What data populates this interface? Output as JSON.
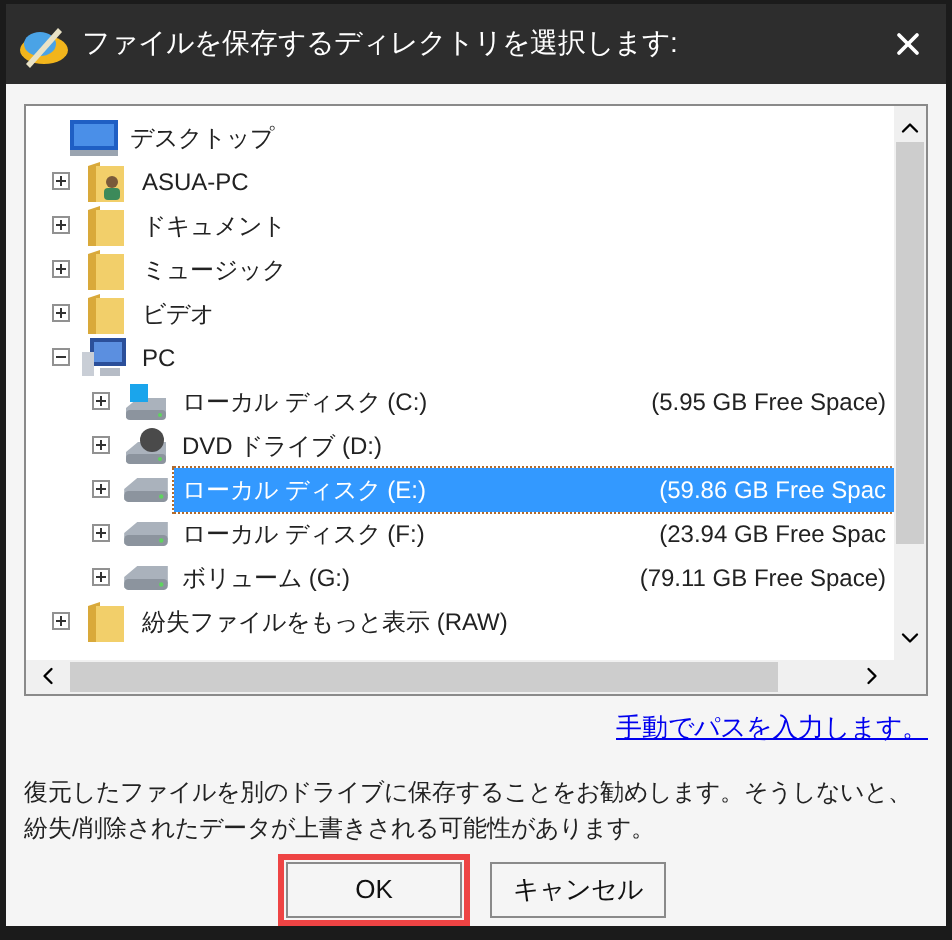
{
  "window": {
    "title": "ファイルを保存するディレクトリを選択します:"
  },
  "tree": [
    {
      "label": "デスクトップ",
      "kind": "desktop",
      "selected": false,
      "children": [
        {
          "label": "ASUA-PC",
          "kind": "user-folder",
          "expanded": false,
          "selected": false
        },
        {
          "label": "ドキュメント",
          "kind": "folder",
          "expanded": false,
          "selected": false
        },
        {
          "label": "ミュージック",
          "kind": "folder",
          "expanded": false,
          "selected": false
        },
        {
          "label": "ビデオ",
          "kind": "folder",
          "expanded": false,
          "selected": false
        },
        {
          "label": "PC",
          "kind": "pc",
          "expanded": true,
          "selected": false,
          "children": [
            {
              "label": "ローカル ディスク (C:)",
              "kind": "windows-drive",
              "free": "(5.95 GB Free Space)",
              "expanded": false,
              "selected": false
            },
            {
              "label": "DVD ドライブ (D:)",
              "kind": "dvd",
              "expanded": false,
              "selected": false
            },
            {
              "label": "ローカル ディスク (E:)",
              "kind": "drive",
              "free": "(59.86 GB Free Spac",
              "expanded": false,
              "selected": true
            },
            {
              "label": "ローカル ディスク (F:)",
              "kind": "drive",
              "free": "(23.94 GB Free Spac",
              "expanded": false,
              "selected": false
            },
            {
              "label": "ボリューム (G:)",
              "kind": "drive",
              "free": "(79.11 GB Free Space)",
              "expanded": false,
              "selected": false
            }
          ]
        },
        {
          "label": "紛失ファイルをもっと表示 (RAW)",
          "kind": "folder",
          "expanded": false,
          "selected": false
        }
      ]
    }
  ],
  "link": "手動でパスを入力します。",
  "message": "復元したファイルを別のドライブに保存することをお勧めします。そうしないと、紛失/削除されたデータが上書きされる可能性があります。",
  "buttons": [
    {
      "label": "OK",
      "highlighted": true
    },
    {
      "label": "キャンセル",
      "highlighted": false
    }
  ]
}
